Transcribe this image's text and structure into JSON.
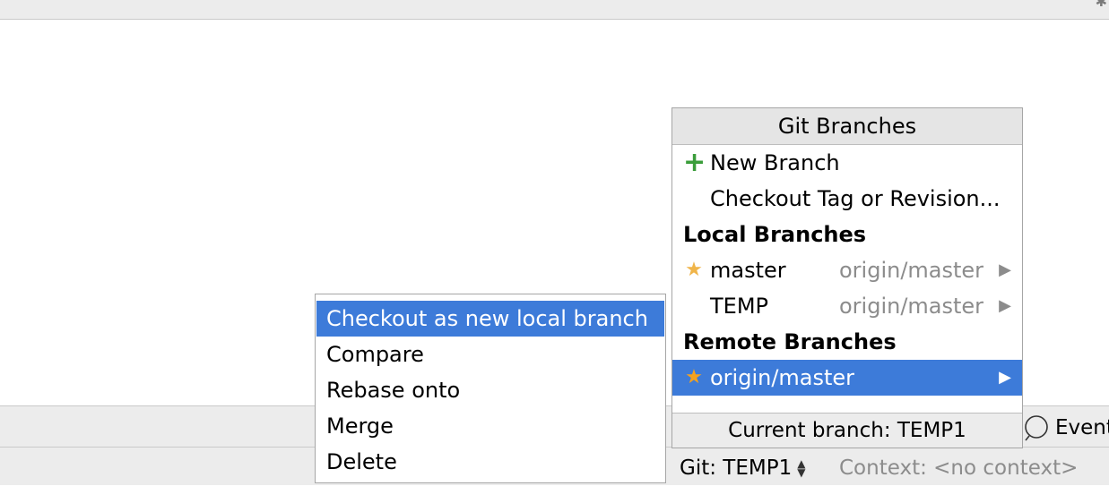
{
  "branches_popup": {
    "title": "Git Branches",
    "actions": [
      {
        "label": "New Branch",
        "icon": "plus-icon"
      },
      {
        "label": "Checkout Tag or Revision..."
      }
    ],
    "local_section": "Local Branches",
    "local_branches": [
      {
        "name": "master",
        "tracking": "origin/master",
        "starred": true
      },
      {
        "name": "TEMP",
        "tracking": "origin/master",
        "starred": false
      }
    ],
    "remote_section": "Remote Branches",
    "remote_branches": [
      {
        "name": "origin/master",
        "starred": true,
        "selected": true
      }
    ],
    "footer": "Current branch: TEMP1"
  },
  "submenu": {
    "items": [
      {
        "label": "Checkout as new local branch",
        "selected": true
      },
      {
        "label": "Compare"
      },
      {
        "label": "Rebase onto"
      },
      {
        "label": "Merge"
      },
      {
        "label": "Delete"
      }
    ]
  },
  "statusbar": {
    "git": "Git: TEMP1",
    "context": "Context: <no context>",
    "event_log": "Event"
  },
  "colors": {
    "selection": "#3d7bd9",
    "star": "#f0b54a",
    "plus": "#3a9d3a"
  }
}
